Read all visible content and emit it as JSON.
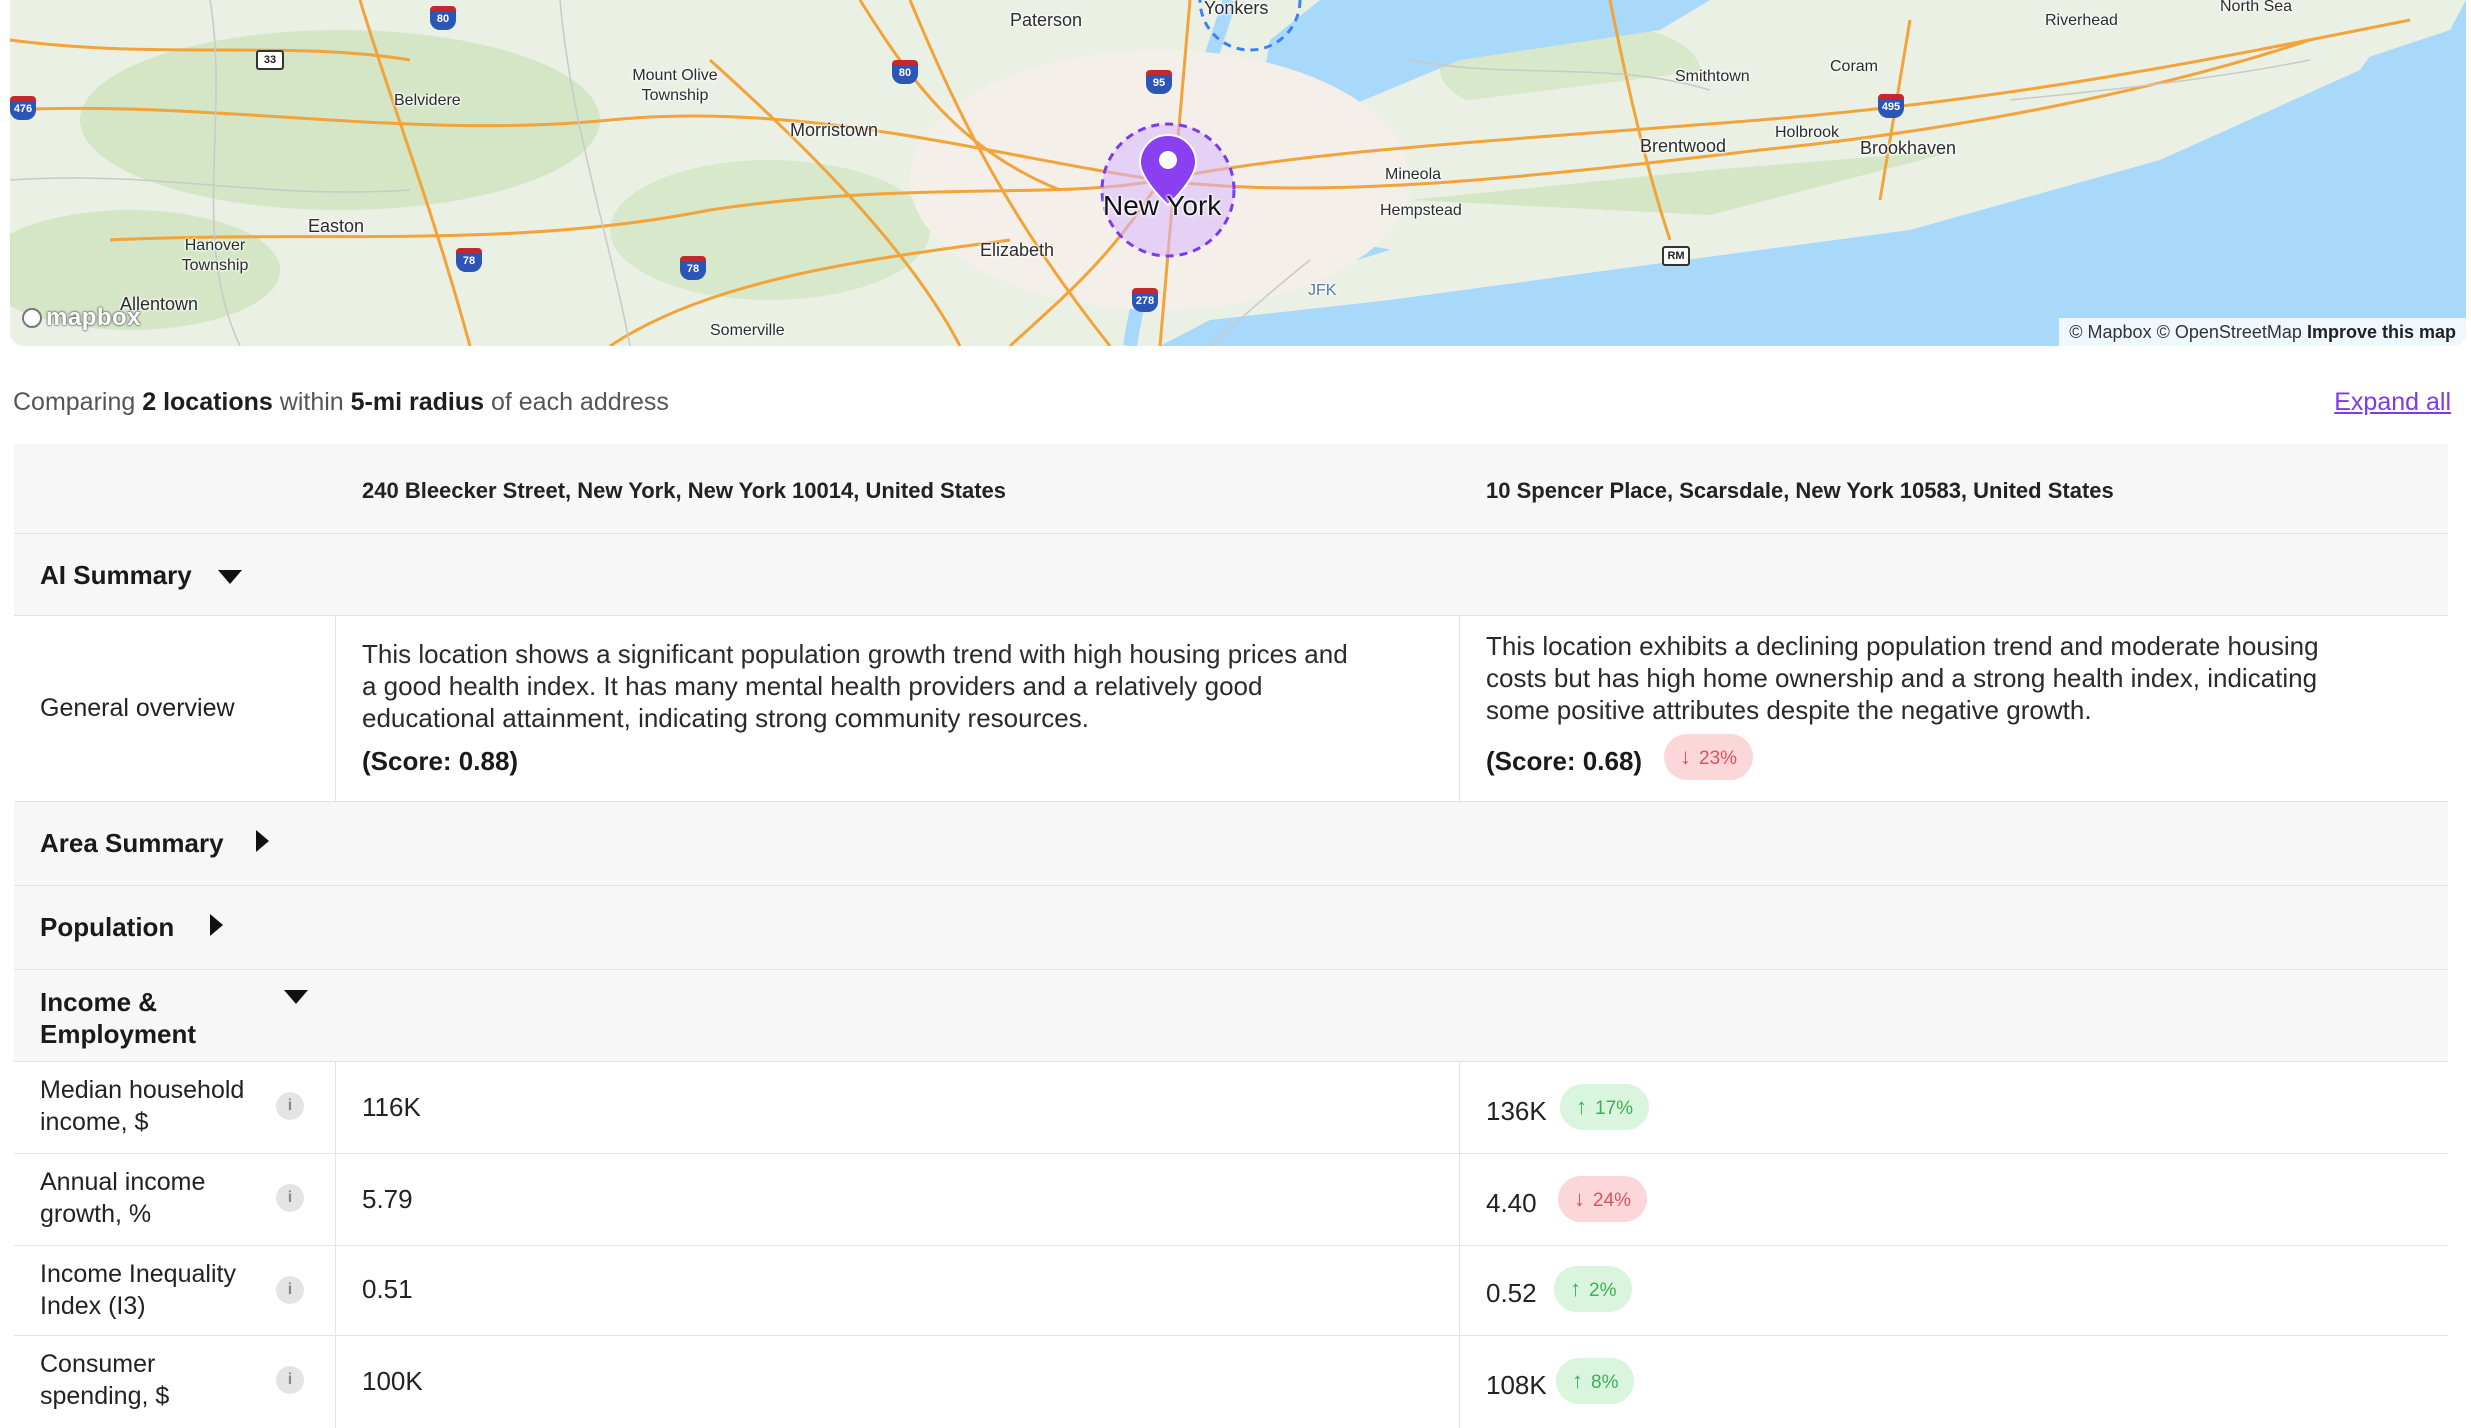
{
  "map": {
    "places": [
      "Paterson",
      "Yonkers",
      "Riverhead",
      "North Sea",
      "Mount Olive Township",
      "Belvidere",
      "Morristown",
      "Smithtown",
      "Coram",
      "Brentwood",
      "Holbrook",
      "Brookhaven",
      "Mineola",
      "Hempstead",
      "New York",
      "Easton",
      "Hanover Township",
      "Elizabeth",
      "JFK",
      "Allentown",
      "Somerville"
    ],
    "shields": [
      "80",
      "33",
      "476",
      "80",
      "95",
      "495",
      "78",
      "78",
      "278",
      "RM"
    ],
    "logo": "mapbox",
    "attribution_mapbox": "© Mapbox",
    "attribution_osm": "© OpenStreetMap",
    "attribution_improve": "Improve this map",
    "colors": {
      "water": "#a8d9fb",
      "land": "#eaf0e4",
      "roads": "#f2a33a",
      "marker": "#8a3ff0"
    }
  },
  "header": {
    "prefix": "Comparing",
    "count": "2 locations",
    "within": "within",
    "radius": "5-mi radius",
    "suffix": "of each address",
    "expand_all": "Expand all"
  },
  "locations": [
    "240 Bleecker Street, New York, New York 10014, United States",
    "10 Spencer Place, Scarsdale, New York 10583, United States"
  ],
  "sections": {
    "ai_summary": "AI Summary",
    "area_summary": "Area Summary",
    "population": "Population",
    "income_line1": "Income &",
    "income_line2": "Employment"
  },
  "overview": {
    "label": "General overview",
    "loc1_lines": [
      "This location shows a significant population growth trend with high housing prices and",
      "a good health index. It has many mental health providers and a relatively good",
      "educational attainment, indicating strong community resources."
    ],
    "loc1_score": "(Score: 0.88)",
    "loc2_lines": [
      "This location exhibits a declining population trend and moderate housing",
      "costs but has high home ownership and a strong health index, indicating",
      "some positive attributes despite the negative growth."
    ],
    "loc2_score": "(Score: 0.68)",
    "loc2_badge": "23%"
  },
  "metrics": [
    {
      "label1": "Median household",
      "label2": "income, $",
      "v1": "116K",
      "v2": "136K",
      "badge": "17%",
      "dir": "up"
    },
    {
      "label1": "Annual income",
      "label2": "growth, %",
      "v1": "5.79",
      "v2": "4.40",
      "badge": "24%",
      "dir": "down"
    },
    {
      "label1": "Income Inequality",
      "label2": "Index (I3)",
      "v1": "0.51",
      "v2": "0.52",
      "badge": "2%",
      "dir": "up"
    },
    {
      "label1": "Consumer",
      "label2": "spending, $",
      "v1": "100K",
      "v2": "108K",
      "badge": "8%",
      "dir": "up"
    }
  ],
  "icons": {
    "info": "i",
    "arrow_up": "↑",
    "arrow_down": "↓"
  }
}
